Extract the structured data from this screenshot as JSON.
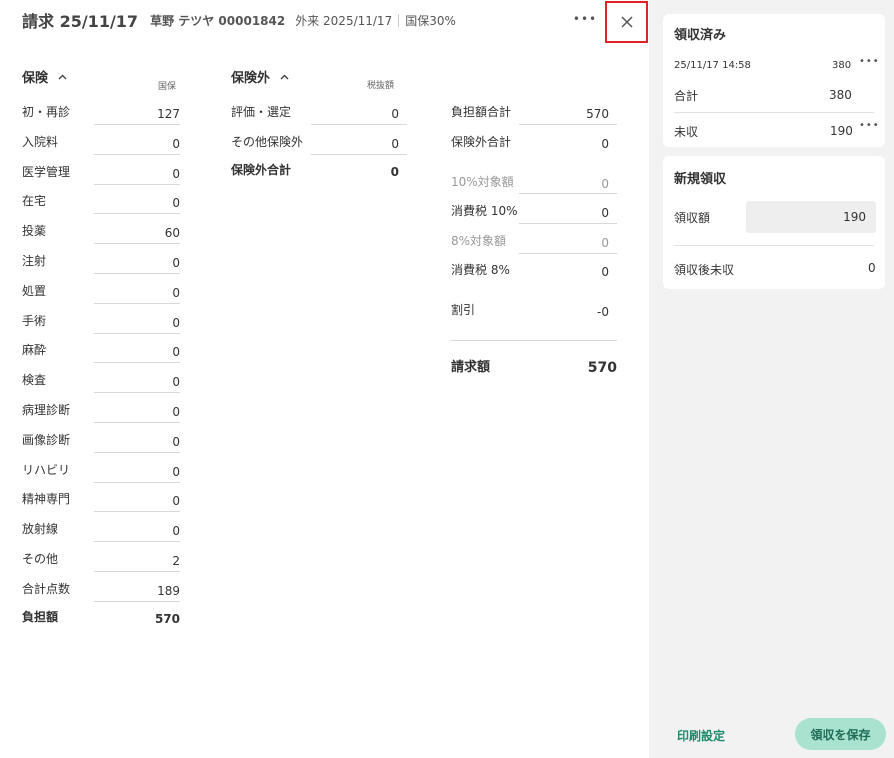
{
  "header": {
    "title": "請求 25/11/17",
    "patient": "草野 テツヤ 00001842",
    "visit": "外来 2025/11/17",
    "insurance": "国保30%",
    "more_label": "•••"
  },
  "insurance": {
    "title": "保険",
    "column_label": "国保",
    "rows": [
      {
        "label": "初・再診",
        "value": "127"
      },
      {
        "label": "入院料",
        "value": "0"
      },
      {
        "label": "医学管理",
        "value": "0"
      },
      {
        "label": "在宅",
        "value": "0"
      },
      {
        "label": "投薬",
        "value": "60"
      },
      {
        "label": "注射",
        "value": "0"
      },
      {
        "label": "処置",
        "value": "0"
      },
      {
        "label": "手術",
        "value": "0"
      },
      {
        "label": "麻酔",
        "value": "0"
      },
      {
        "label": "検査",
        "value": "0"
      },
      {
        "label": "病理診断",
        "value": "0"
      },
      {
        "label": "画像診断",
        "value": "0"
      },
      {
        "label": "リハビリ",
        "value": "0"
      },
      {
        "label": "精神専門",
        "value": "0"
      },
      {
        "label": "放射線",
        "value": "0"
      },
      {
        "label": "その他",
        "value": "2"
      },
      {
        "label": "合計点数",
        "value": "189"
      }
    ],
    "burden": {
      "label": "負担額",
      "value": "570"
    }
  },
  "non_insurance": {
    "title": "保険外",
    "column_label": "税抜額",
    "rows": [
      {
        "label": "評価・選定",
        "value": "0"
      },
      {
        "label": "その他保険外",
        "value": "0"
      }
    ],
    "total": {
      "label": "保険外合計",
      "value": "0"
    }
  },
  "summary": {
    "burden_total": {
      "label": "負担額合計",
      "value": "570"
    },
    "non_ins_total": {
      "label": "保険外合計",
      "value": "0"
    },
    "taxable10": {
      "label": "10%対象額",
      "value": "0"
    },
    "tax10": {
      "label": "消費税 10%",
      "value": "0"
    },
    "taxable8": {
      "label": "8%対象額",
      "value": "0"
    },
    "tax8": {
      "label": "消費税 8%",
      "value": "0"
    },
    "discount": {
      "label": "割引",
      "value": "-0"
    },
    "billed": {
      "label": "請求額",
      "value": "570"
    }
  },
  "received_card": {
    "title": "領収済み",
    "entry_date": "25/11/17 14:58",
    "entry_amount": "380",
    "total_label": "合計",
    "total_value": "380",
    "unpaid_label": "未収",
    "unpaid_value": "190"
  },
  "new_receipt_card": {
    "title": "新規領収",
    "amount_label": "領収額",
    "amount_value": "190",
    "after_label": "領収後未収",
    "after_value": "0"
  },
  "footer": {
    "print_label": "印刷設定",
    "save_label": "領収を保存"
  },
  "colors": {
    "accent": "#1d8a6b",
    "save_bg": "#a9e3cf",
    "close_highlight": "#e02424",
    "panel_bg": "#f2f2f2"
  }
}
